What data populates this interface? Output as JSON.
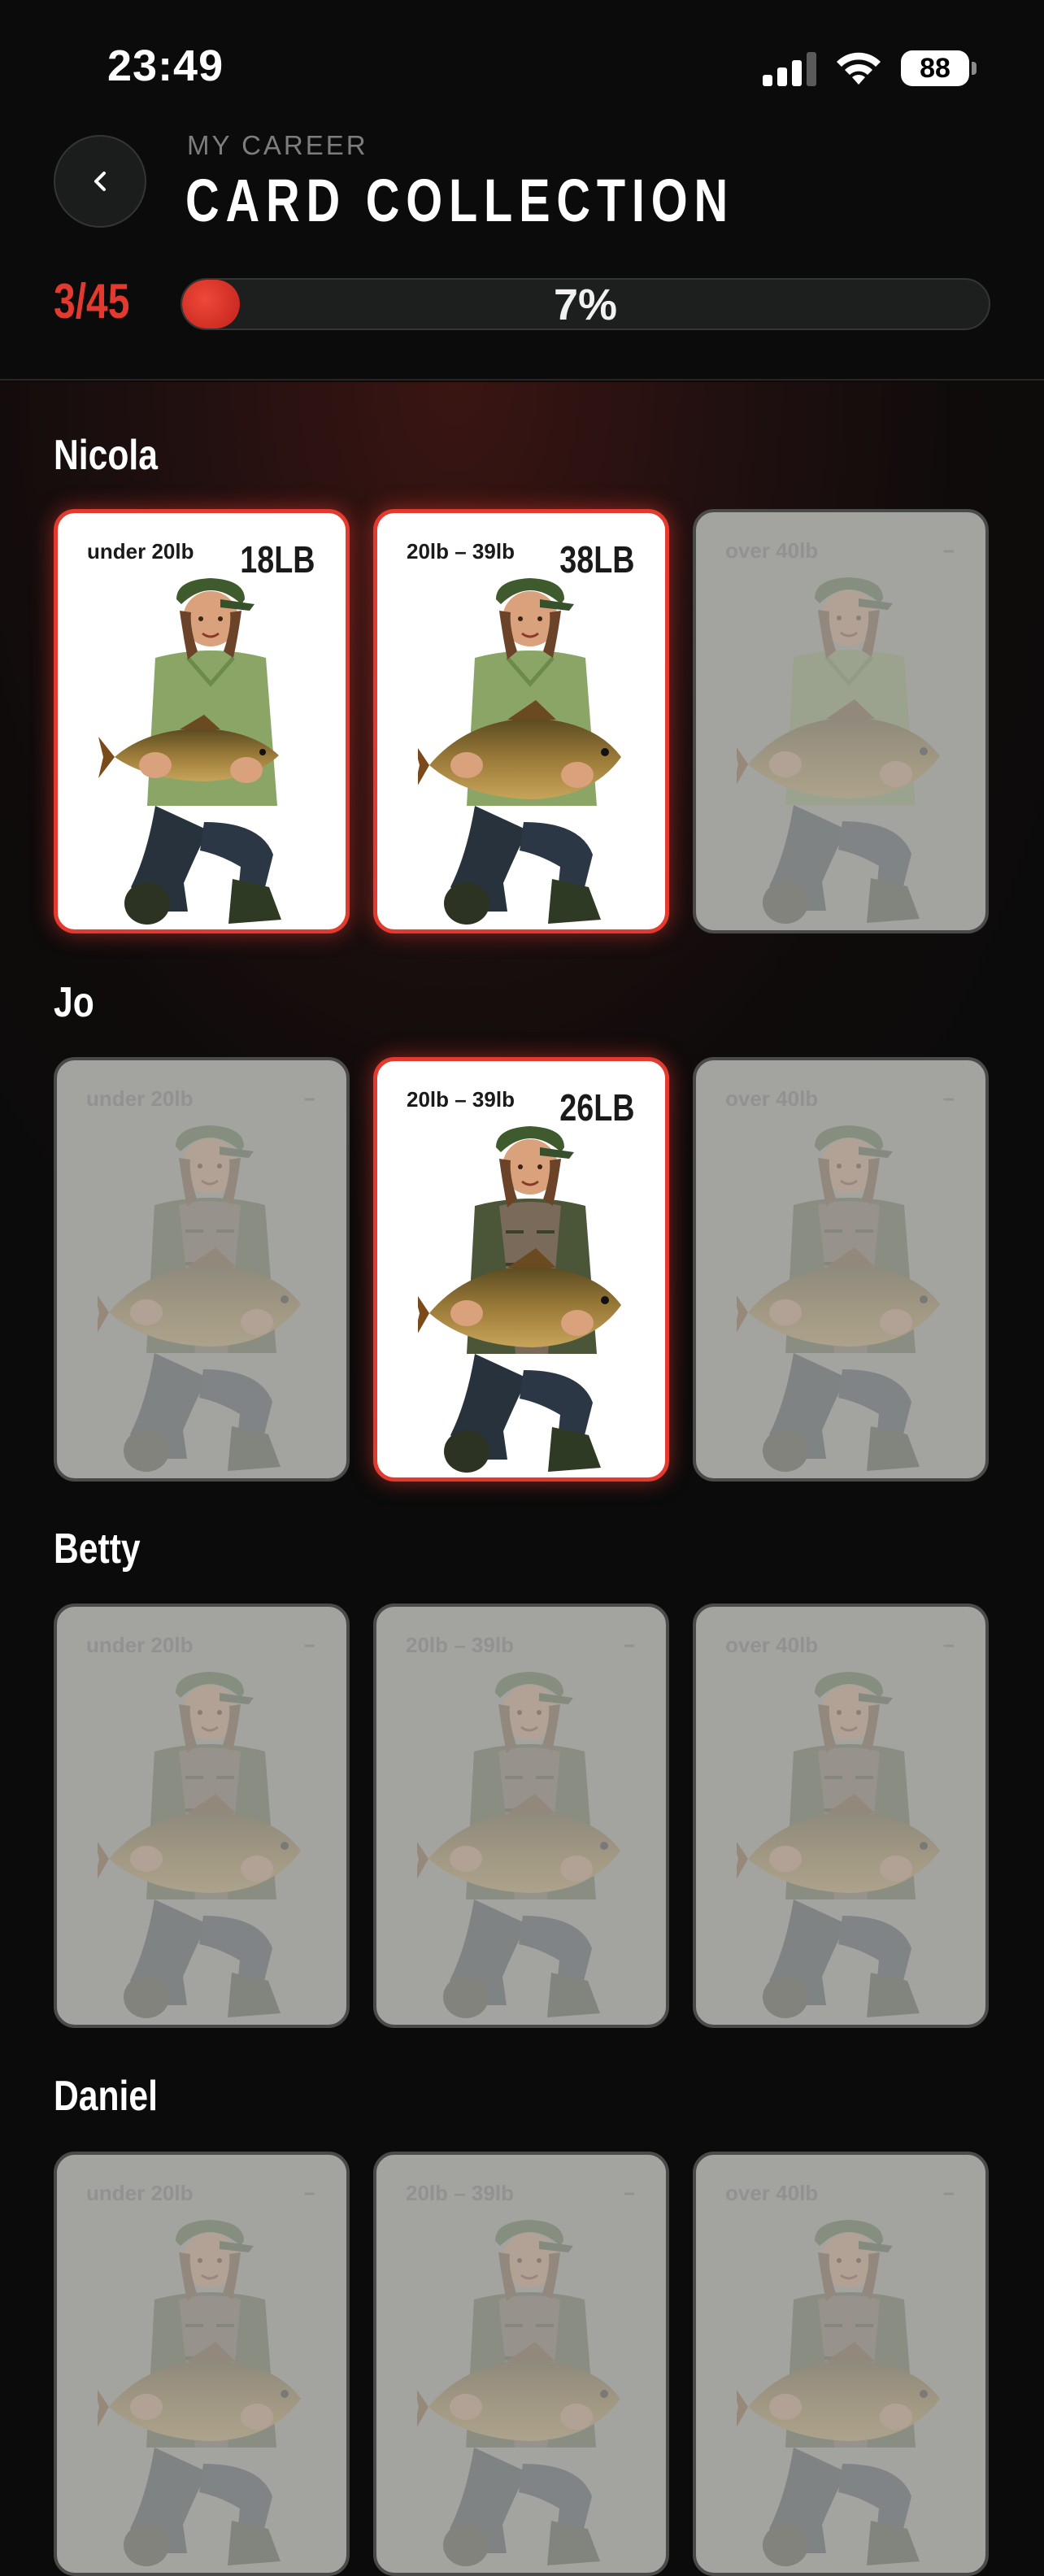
{
  "status_bar": {
    "time": "23:49",
    "battery": "88"
  },
  "header": {
    "subtitle": "MY CAREER",
    "title": "CARD COLLECTION"
  },
  "progress": {
    "count": "3/45",
    "percent_label": "7%",
    "fraction": 0.07
  },
  "sections": [
    {
      "name": "Nicola",
      "cards": [
        {
          "range": "under 20lb",
          "weight": "18LB",
          "unlocked": true
        },
        {
          "range": "20lb – 39lb",
          "weight": "38LB",
          "unlocked": true
        },
        {
          "range": "over 40lb",
          "weight": "–",
          "unlocked": false
        }
      ]
    },
    {
      "name": "Jo",
      "cards": [
        {
          "range": "under 20lb",
          "weight": "–",
          "unlocked": false
        },
        {
          "range": "20lb – 39lb",
          "weight": "26LB",
          "unlocked": true
        },
        {
          "range": "over 40lb",
          "weight": "–",
          "unlocked": false
        }
      ]
    },
    {
      "name": "Betty",
      "cards": [
        {
          "range": "under 20lb",
          "weight": "–",
          "unlocked": false
        },
        {
          "range": "20lb – 39lb",
          "weight": "–",
          "unlocked": false
        },
        {
          "range": "over 40lb",
          "weight": "–",
          "unlocked": false
        }
      ]
    },
    {
      "name": "Daniel",
      "cards": [
        {
          "range": "under 20lb",
          "weight": "–",
          "unlocked": false
        },
        {
          "range": "20lb – 39lb",
          "weight": "–",
          "unlocked": false
        },
        {
          "range": "over 40lb",
          "weight": "–",
          "unlocked": false
        }
      ]
    }
  ],
  "colors": {
    "accent": "#e23a2e",
    "background": "#0b0b0b",
    "locked_card": "#a3a3a0"
  }
}
